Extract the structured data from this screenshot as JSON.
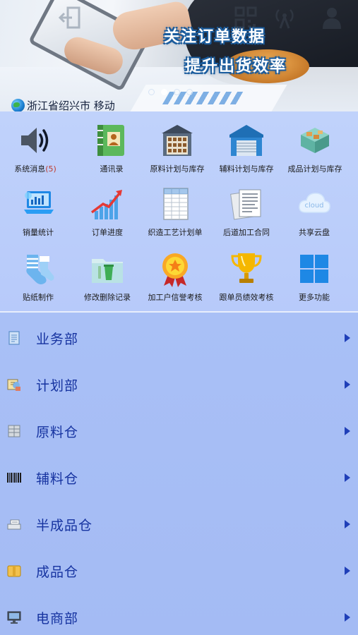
{
  "banner": {
    "slogan_line1": "关注订单数据",
    "slogan_line2": "提升出货效率",
    "location": "浙江省绍兴市 移动",
    "carousel_pages": 4,
    "carousel_active": 2
  },
  "grid": {
    "items": [
      {
        "label": "系统消息",
        "count": "(5)",
        "icon": "speaker-icon"
      },
      {
        "label": "通讯录",
        "icon": "contacts-book-icon"
      },
      {
        "label": "原料计划与库存",
        "icon": "warehouse-shelves-icon"
      },
      {
        "label": "辅料计划与库存",
        "icon": "warehouse-blue-icon"
      },
      {
        "label": "成品计划与库存",
        "icon": "isometric-warehouse-icon"
      },
      {
        "label": "销量统计",
        "icon": "laptop-chart-icon"
      },
      {
        "label": "订单进度",
        "icon": "growth-chart-icon"
      },
      {
        "label": "织造工艺计划单",
        "icon": "spreadsheet-icon"
      },
      {
        "label": "后道加工合同",
        "icon": "contract-documents-icon"
      },
      {
        "label": "共享云盘",
        "icon": "cloud-icon"
      },
      {
        "label": "贴纸制作",
        "icon": "socks-icon"
      },
      {
        "label": "修改删除记录",
        "icon": "folder-trash-icon"
      },
      {
        "label": "加工户信誉考核",
        "icon": "gold-medal-icon"
      },
      {
        "label": "跟单员绩效考核",
        "icon": "trophy-icon"
      },
      {
        "label": "更多功能",
        "icon": "windows-grid-icon"
      }
    ]
  },
  "departments": [
    {
      "label": "业务部",
      "icon": "document-icon"
    },
    {
      "label": "计划部",
      "icon": "planning-icon"
    },
    {
      "label": "原料仓",
      "icon": "storage-icon"
    },
    {
      "label": "辅料仓",
      "icon": "barcode-icon"
    },
    {
      "label": "半成品仓",
      "icon": "tray-icon"
    },
    {
      "label": "成品仓",
      "icon": "package-icon"
    },
    {
      "label": "电商部",
      "icon": "monitor-icon"
    }
  ],
  "colors": {
    "grid_bg": "#c0d2fb",
    "list_bg": "#a9c0f6",
    "dept_text": "#1633a0",
    "arrow": "#1f3fb8",
    "badge_count": "#c0392b"
  }
}
